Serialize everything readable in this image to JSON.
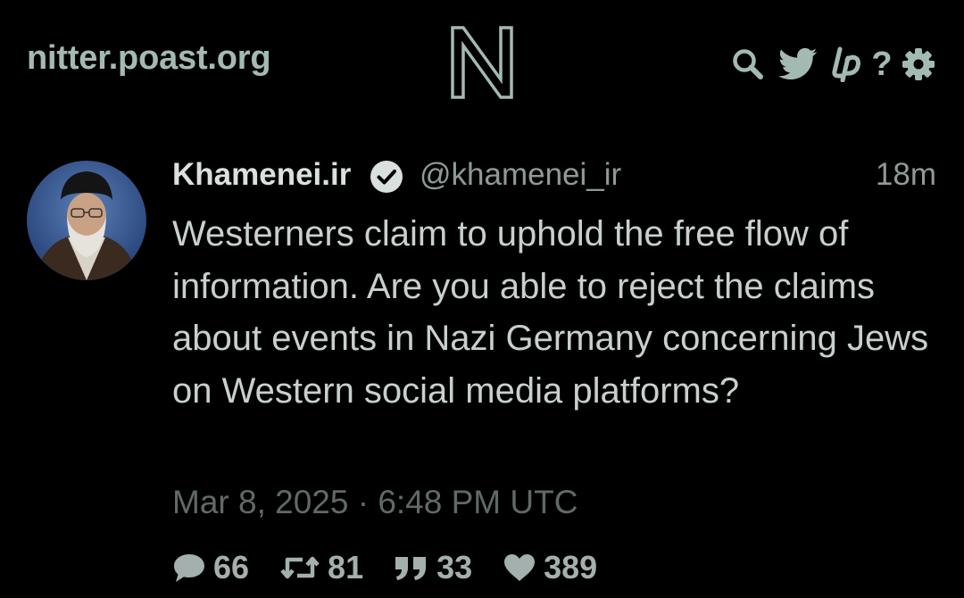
{
  "nav": {
    "site_name": "nitter.poast.org",
    "logo_letter": "N",
    "icons": [
      "search-icon",
      "twitter-bird-icon",
      "liberapay-icon",
      "help-icon",
      "gear-icon"
    ],
    "help_label": "?"
  },
  "tweet": {
    "fullname": "Khamenei.ir",
    "verified_icon": "verified-check-icon",
    "username": "@khamenei_ir",
    "relative_time": "18m",
    "text": "Westerners claim to uphold the free flow of information. Are you able to reject the claims about events in Nazi Germany concerning Jews on Western social media platforms?",
    "published": "Mar 8, 2025 · 6:48 PM UTC",
    "stats": {
      "comments": "66",
      "retweets": "81",
      "quotes": "33",
      "likes": "389"
    }
  },
  "colors": {
    "background": "#000000",
    "accent": "#a3bab3",
    "text": "#c7d0cd",
    "muted": "#8d9b98",
    "date": "#5f6a68"
  }
}
